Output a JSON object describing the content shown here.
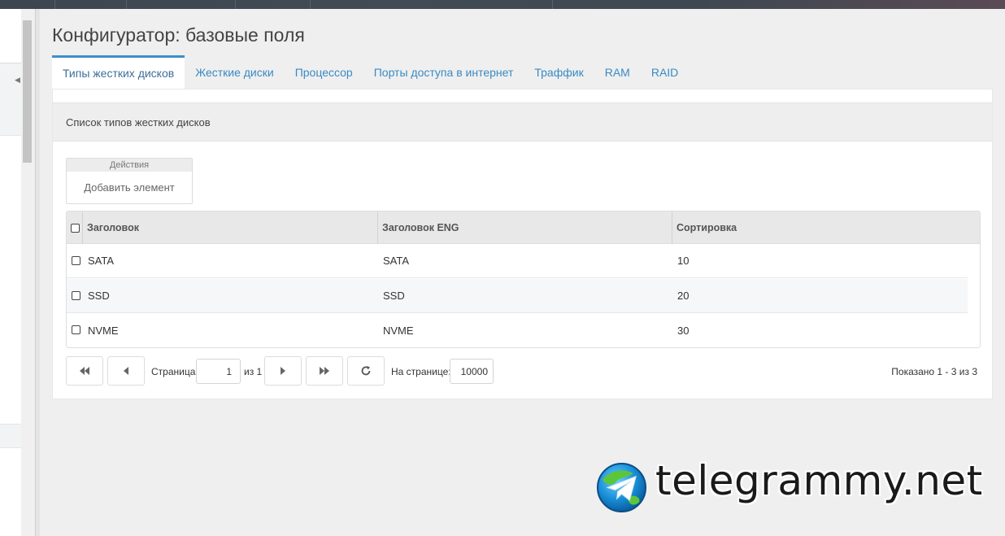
{
  "page": {
    "title": "Конфигуратор: базовые поля"
  },
  "tabs": [
    {
      "label": "Типы жестких дисков",
      "active": true
    },
    {
      "label": "Жесткие диски"
    },
    {
      "label": "Процессор"
    },
    {
      "label": "Порты доступа в интернет"
    },
    {
      "label": "Траффик"
    },
    {
      "label": "RAM"
    },
    {
      "label": "RAID"
    }
  ],
  "card": {
    "header": "Список типов жестких дисков",
    "actions_title": "Действия",
    "add_label": "Добавить элемент"
  },
  "table": {
    "columns": [
      "Заголовок",
      "Заголовок ENG",
      "Сортировка"
    ],
    "rows": [
      {
        "title": "SATA",
        "title_eng": "SATA",
        "sort": "10"
      },
      {
        "title": "SSD",
        "title_eng": "SSD",
        "sort": "20"
      },
      {
        "title": "NVME",
        "title_eng": "NVME",
        "sort": "30"
      }
    ]
  },
  "pager": {
    "page_label": "Страница",
    "page_value": "1",
    "of_label": "из 1",
    "per_page_label": "На странице:",
    "per_page_value": "10000",
    "shown": "Показано 1 - 3 из 3"
  },
  "watermark": {
    "text": "telegrammy.net"
  },
  "colors": {
    "tab_link": "#3a8ac4",
    "tab_active_border": "#3b8fc9"
  }
}
